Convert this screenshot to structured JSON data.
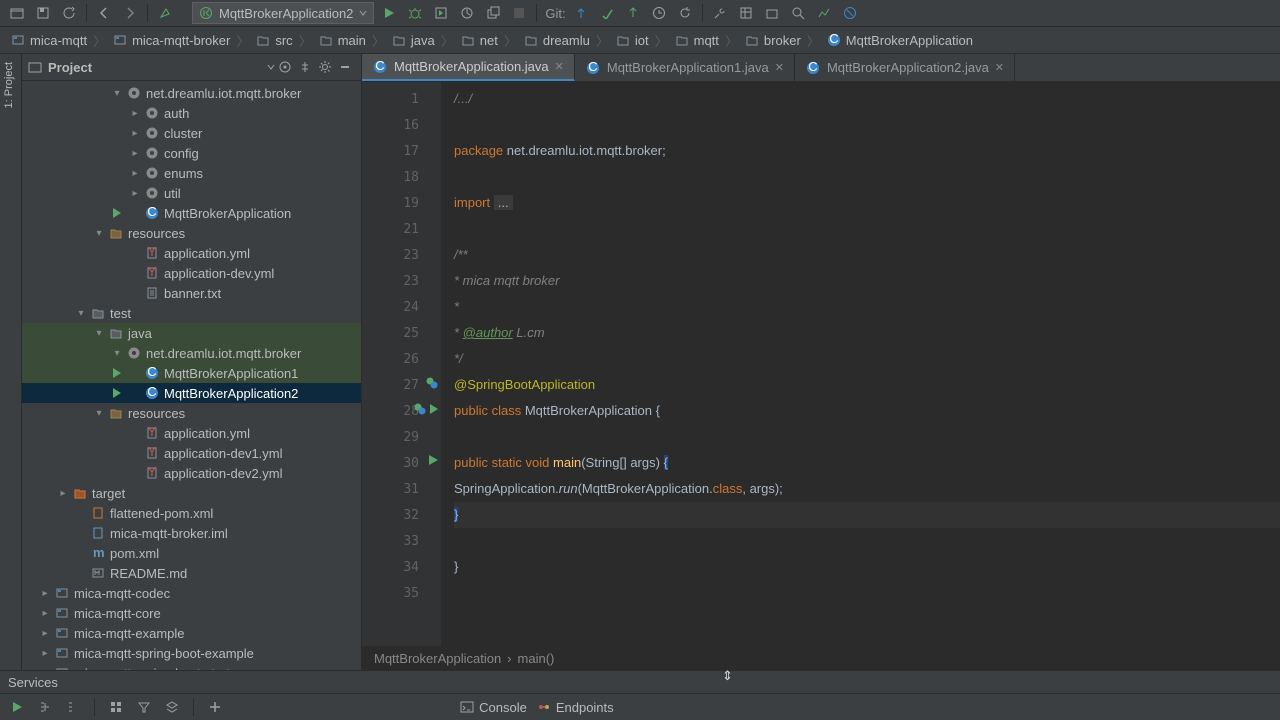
{
  "run_config": {
    "label": "MqttBrokerApplication2"
  },
  "git_label": "Git:",
  "breadcrumbs": [
    {
      "label": "mica-mqtt",
      "icon": "module"
    },
    {
      "label": "mica-mqtt-broker",
      "icon": "module"
    },
    {
      "label": "src",
      "icon": "folder"
    },
    {
      "label": "main",
      "icon": "folder"
    },
    {
      "label": "java",
      "icon": "folder"
    },
    {
      "label": "net",
      "icon": "folder"
    },
    {
      "label": "dreamlu",
      "icon": "folder"
    },
    {
      "label": "iot",
      "icon": "folder"
    },
    {
      "label": "mqtt",
      "icon": "folder"
    },
    {
      "label": "broker",
      "icon": "folder"
    },
    {
      "label": "MqttBrokerApplication",
      "icon": "class"
    }
  ],
  "project_tool": {
    "title": "Project"
  },
  "left_tab": "1: Project",
  "tree": [
    {
      "d": 5,
      "arrow": "▾",
      "icon": "pkg",
      "label": "net.dreamlu.iot.mqtt.broker"
    },
    {
      "d": 6,
      "arrow": "▸",
      "icon": "pkg",
      "label": "auth"
    },
    {
      "d": 6,
      "arrow": "▸",
      "icon": "pkg",
      "label": "cluster"
    },
    {
      "d": 6,
      "arrow": "▸",
      "icon": "pkg",
      "label": "config"
    },
    {
      "d": 6,
      "arrow": "▸",
      "icon": "pkg",
      "label": "enums"
    },
    {
      "d": 6,
      "arrow": "▸",
      "icon": "pkg",
      "label": "util"
    },
    {
      "d": 6,
      "arrow": "",
      "icon": "class",
      "label": "MqttBrokerApplication",
      "run": true
    },
    {
      "d": 4,
      "arrow": "▾",
      "icon": "res",
      "label": "resources"
    },
    {
      "d": 6,
      "arrow": "",
      "icon": "yml",
      "label": "application.yml"
    },
    {
      "d": 6,
      "arrow": "",
      "icon": "yml",
      "label": "application-dev.yml"
    },
    {
      "d": 6,
      "arrow": "",
      "icon": "txt",
      "label": "banner.txt"
    },
    {
      "d": 3,
      "arrow": "▾",
      "icon": "dir",
      "label": "test"
    },
    {
      "d": 4,
      "arrow": "▾",
      "icon": "dir",
      "label": "java",
      "hl": "pkg"
    },
    {
      "d": 5,
      "arrow": "▾",
      "icon": "pkg",
      "label": "net.dreamlu.iot.mqtt.broker",
      "hl": "pkg"
    },
    {
      "d": 6,
      "arrow": "",
      "icon": "class",
      "label": "MqttBrokerApplication1",
      "run": true,
      "hl": "pkg"
    },
    {
      "d": 6,
      "arrow": "",
      "icon": "class",
      "label": "MqttBrokerApplication2",
      "run": true,
      "sel": true
    },
    {
      "d": 4,
      "arrow": "▾",
      "icon": "res",
      "label": "resources"
    },
    {
      "d": 6,
      "arrow": "",
      "icon": "yml",
      "label": "application.yml"
    },
    {
      "d": 6,
      "arrow": "",
      "icon": "yml",
      "label": "application-dev1.yml"
    },
    {
      "d": 6,
      "arrow": "",
      "icon": "yml",
      "label": "application-dev2.yml"
    },
    {
      "d": 2,
      "arrow": "▸",
      "icon": "target",
      "label": "target"
    },
    {
      "d": 3,
      "arrow": "",
      "icon": "xml",
      "label": "flattened-pom.xml",
      "dim": true
    },
    {
      "d": 3,
      "arrow": "",
      "icon": "iml",
      "label": "mica-mqtt-broker.iml",
      "dim": true
    },
    {
      "d": 3,
      "arrow": "",
      "icon": "mvn",
      "label": "pom.xml"
    },
    {
      "d": 3,
      "arrow": "",
      "icon": "md",
      "label": "README.md"
    },
    {
      "d": 1,
      "arrow": "▸",
      "icon": "module",
      "label": "mica-mqtt-codec"
    },
    {
      "d": 1,
      "arrow": "▸",
      "icon": "module",
      "label": "mica-mqtt-core"
    },
    {
      "d": 1,
      "arrow": "▸",
      "icon": "module",
      "label": "mica-mqtt-example"
    },
    {
      "d": 1,
      "arrow": "▸",
      "icon": "module",
      "label": "mica-mqtt-spring-boot-example"
    },
    {
      "d": 1,
      "arrow": "▸",
      "icon": "module",
      "label": "mica-mqtt-spring-boot-starter"
    }
  ],
  "editor_tabs": [
    {
      "label": "MqttBrokerApplication.java",
      "active": true
    },
    {
      "label": "MqttBrokerApplication1.java",
      "active": false
    },
    {
      "label": "MqttBrokerApplication2.java",
      "active": false
    }
  ],
  "gutter_lines": [
    1,
    16,
    17,
    18,
    19,
    21,
    23,
    23,
    24,
    25,
    26,
    27,
    28,
    29,
    30,
    31,
    32,
    33,
    34,
    35
  ],
  "gutter_marks": {
    "27": "nav",
    "28": "nav-run",
    "30": "run"
  },
  "code_lines": [
    {
      "html": "<span class='cm'>/.../</span>"
    },
    {
      "html": ""
    },
    {
      "html": "<span class='kw'>package</span> net.dreamlu.iot.mqtt.broker;"
    },
    {
      "html": ""
    },
    {
      "html": "<span class='kw'>import</span> <span style='background:#3b3b3b;padding:0 4px;'>...</span>"
    },
    {
      "html": ""
    },
    {
      "html": "<span class='cm'>/**</span>"
    },
    {
      "html": "<span class='cm'> * mica mqtt broker</span>"
    },
    {
      "html": "<span class='cm'> *</span>"
    },
    {
      "html": "<span class='cm'> * <span class='cmau'>@author</span> L.cm</span>"
    },
    {
      "html": "<span class='cm'> */</span>"
    },
    {
      "html": "<span class='ann'>@SpringBootApplication</span>"
    },
    {
      "html": "<span class='kw'>public class</span> MqttBrokerApplication {"
    },
    {
      "html": ""
    },
    {
      "html": "    <span class='kw'>public static void</span> <span class='fn'>main</span>(String[] args) <span class='hl'>{</span>"
    },
    {
      "html": "        SpringApplication.<span class='it'>run</span>(MqttBrokerApplication.<span class='kw'>class</span>, args);"
    },
    {
      "html": "    <span class='hl'>}</span>",
      "caret": true
    },
    {
      "html": ""
    },
    {
      "html": "}"
    },
    {
      "html": ""
    }
  ],
  "editor_crumb": {
    "a": "MqttBrokerApplication",
    "b": "main()"
  },
  "services_label": "Services",
  "bottom_tabs": {
    "console": "Console",
    "endpoints": "Endpoints"
  }
}
